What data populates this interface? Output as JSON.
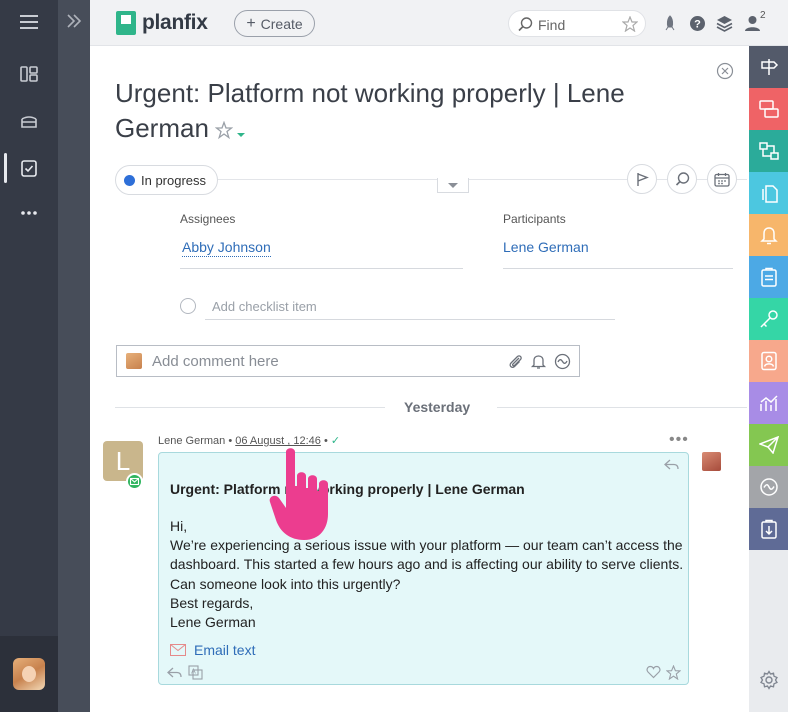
{
  "app": {
    "logo_text": "planfix"
  },
  "topbar": {
    "create_label": "Create",
    "search_placeholder": "Find",
    "notification_count": "2"
  },
  "task": {
    "title": "Urgent: Platform not working properly | Lene German",
    "status": "In progress",
    "status_color": "#2e6fd8",
    "assignees_label": "Assignees",
    "assignee": "Abby Johnson",
    "participants_label": "Participants",
    "participant": "Lene German",
    "checklist_placeholder": "Add checklist item",
    "comment_placeholder": "Add comment here"
  },
  "feed": {
    "day_label": "Yesterday",
    "message": {
      "avatar_letter": "L",
      "author": "Lene German",
      "date": "06 August , 12:46",
      "subject": "Urgent: Platform not working properly | Lene German",
      "body": [
        "Hi,",
        "We’re experiencing a serious issue with your platform — our team can’t access the dashboard. This started a few hours ago and is affecting our ability to serve clients.",
        "Can someone look into this urgently?",
        "Best regards,",
        "Lene German"
      ],
      "email_text_link": "Email text"
    }
  },
  "right_rail": {
    "items": [
      {
        "icon": "signpost-icon",
        "color": "#535a6a"
      },
      {
        "icon": "task-transfer-icon",
        "color": "#ef6366"
      },
      {
        "icon": "flow-icon",
        "color": "#2bab9a"
      },
      {
        "icon": "files-icon",
        "color": "#4cc7e0"
      },
      {
        "icon": "bell-icon",
        "color": "#f7b66b"
      },
      {
        "icon": "clipboard-icon",
        "color": "#4ca9e5"
      },
      {
        "icon": "key-icon",
        "color": "#35d6a6"
      },
      {
        "icon": "contact-icon",
        "color": "#f7a88c"
      },
      {
        "icon": "analytics-icon",
        "color": "#a88ce6"
      },
      {
        "icon": "send-icon",
        "color": "#84c751"
      },
      {
        "icon": "integration-icon",
        "color": "#a3a5a9"
      },
      {
        "icon": "checklist-transfer-icon",
        "color": "#5f6b96"
      }
    ]
  }
}
